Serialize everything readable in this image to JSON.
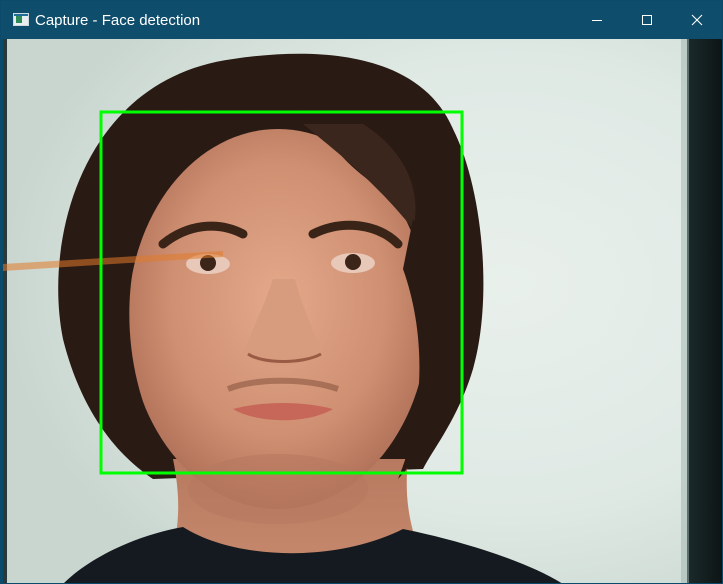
{
  "window": {
    "title": "Capture - Face detection",
    "icons": {
      "app": "app-window-icon",
      "minimize": "minimize-icon",
      "maximize": "maximize-icon",
      "close": "close-icon"
    },
    "colors": {
      "titlebar": "#0f4d6c",
      "title_text": "#ffffff"
    }
  },
  "capture": {
    "detections": 1,
    "box_color": "#00ff00"
  }
}
